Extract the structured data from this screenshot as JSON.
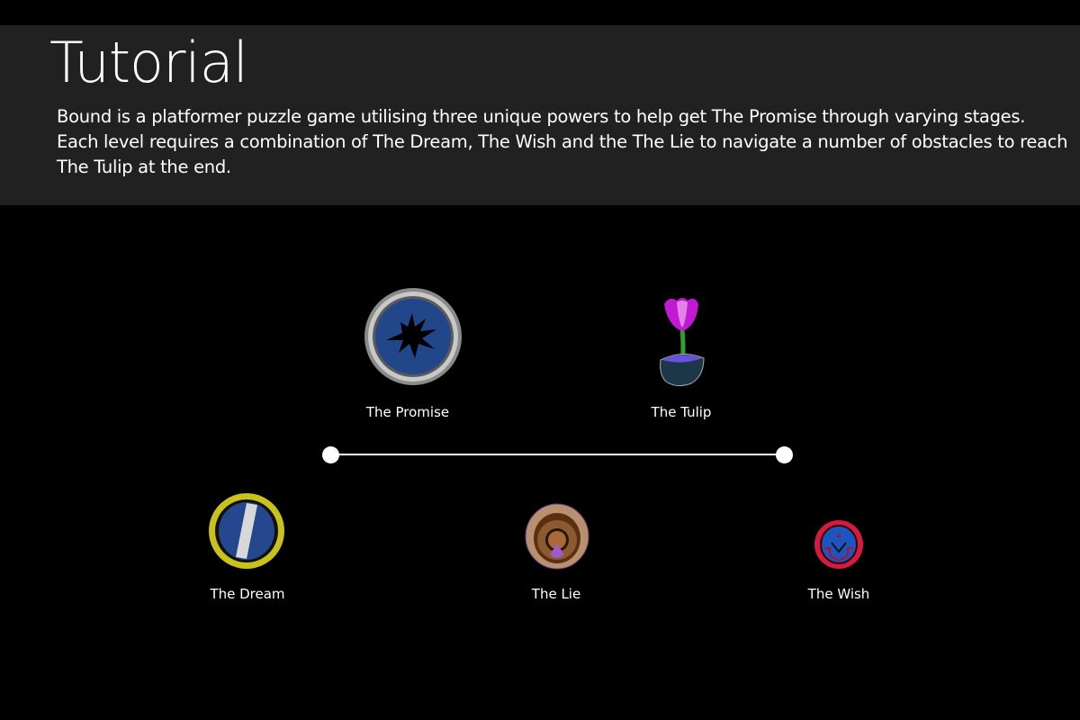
{
  "header": {
    "title": "Tutorial",
    "description": "Bound is a platformer puzzle game utilising three unique powers to help get The Promise through varying stages. Each level requires a combination of The Dream, The Wish and the The Lie to navigate a number of obstacles to reach The Tulip at the end."
  },
  "characters": {
    "promise": "The Promise",
    "tulip": "The Tulip",
    "dream": "The Dream",
    "lie": "The Lie",
    "wish": "The Wish"
  },
  "progress": {
    "value": 0,
    "min": 0,
    "max": 1
  }
}
